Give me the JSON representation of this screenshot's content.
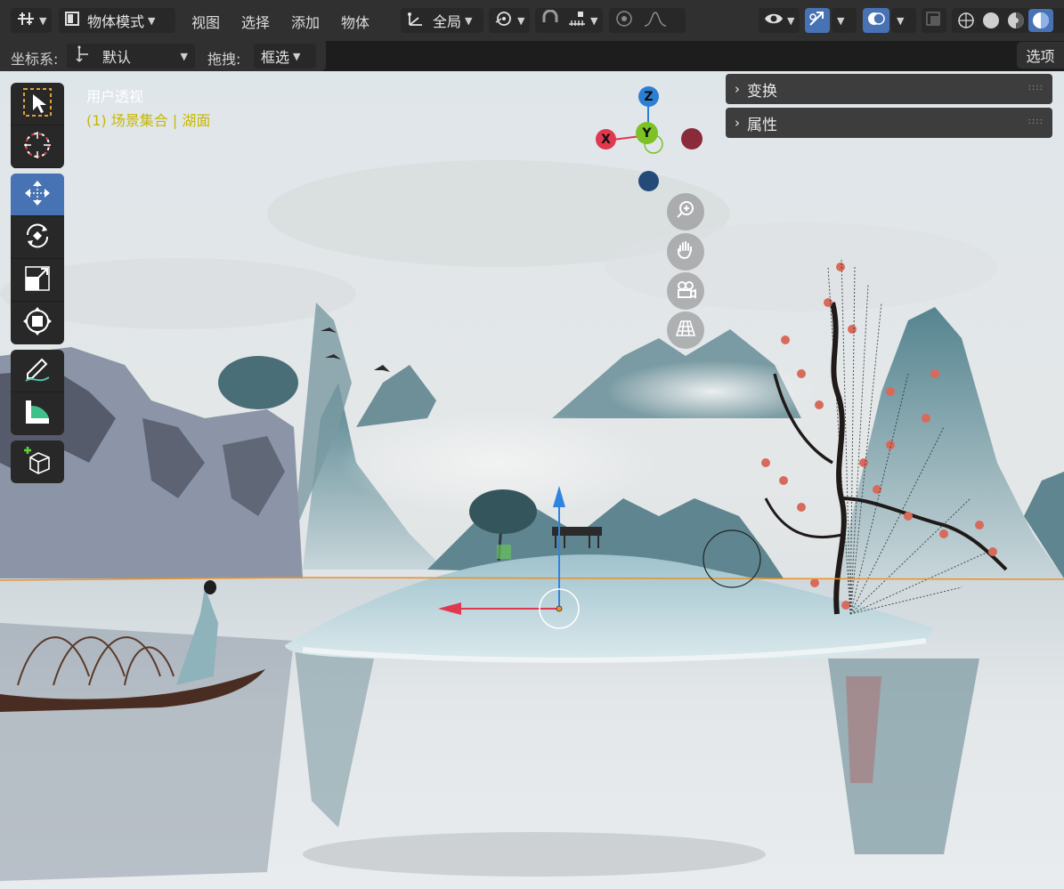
{
  "header": {
    "mode_label": "物体模式",
    "menus": [
      "视图",
      "选择",
      "添加",
      "物体"
    ],
    "orientation_label": "全局"
  },
  "toolsettings": {
    "coord_label": "坐标系:",
    "coord_value": "默认",
    "drag_label": "拖拽:",
    "drag_value": "框选",
    "options_label": "选项"
  },
  "viewport": {
    "view_name": "用户透视",
    "collection_info": "(1) 场景集合 | 湖面"
  },
  "gizmo": {
    "z": "Z",
    "y": "Y",
    "x": "X"
  },
  "npanel": {
    "transform_label": "变换",
    "attributes_label": "属性"
  },
  "colors": {
    "accent": "#4772b3",
    "info_yellow": "#c8b800",
    "axis_x": "#e0384f",
    "axis_y": "#7cc225",
    "axis_z": "#2d7fd3"
  },
  "icons": {
    "editor_type": "scene-nodes-icon",
    "mode": "object-mode-icon",
    "orientation": "transform-axes-icon",
    "pivot": "pivot-icon",
    "snap": "magnet-icon",
    "snap_target": "snap-increment-icon",
    "proportional": "proportional-edit-icon",
    "falloff": "falloff-curve-icon",
    "visibility": "eye-icon",
    "gizmo_toggle": "gizmo-arrow-icon",
    "overlays": "overlays-icon",
    "xray": "xray-icon",
    "shading_wire": "wireframe-shading-icon",
    "shading_solid": "solid-shading-icon",
    "shading_material": "material-shading-icon",
    "shading_render": "rendered-shading-icon"
  }
}
